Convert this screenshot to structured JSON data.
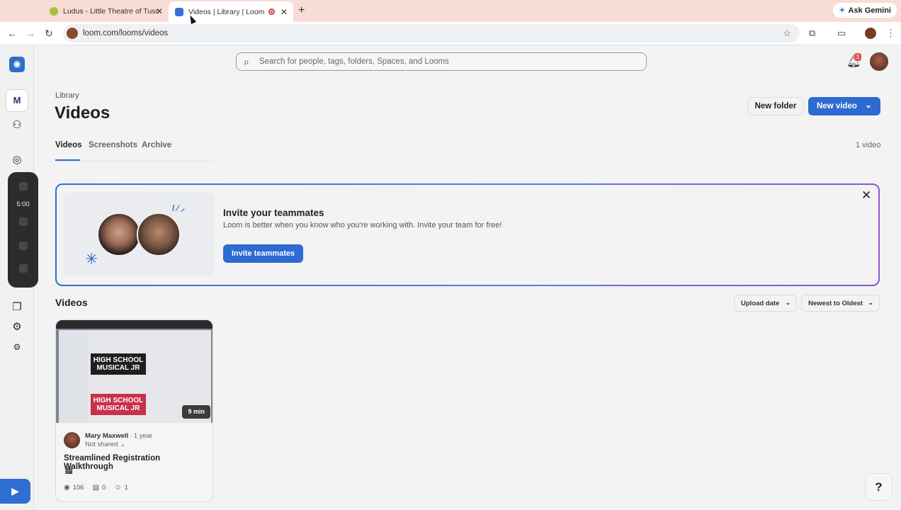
{
  "browser": {
    "tabs": [
      {
        "title": "Ludus - Little Theatre of Tusc",
        "fav_color": "#a8c03c"
      },
      {
        "title": "Videos | Library | Loom",
        "fav_color": "#3b6fd1"
      }
    ],
    "new_tab_glyph": "+",
    "close_glyph": "✕",
    "ask_gemini": "Ask Gemini",
    "url": "loom.com/looms/videos"
  },
  "app": {
    "workspace_initial": "M",
    "recorder_time": "5:00",
    "search_placeholder": "Search for people, tags, folders, Spaces, and Looms",
    "notification_count": "1",
    "breadcrumb": "Library",
    "title": "Videos",
    "new_folder": "New folder",
    "new_video": "New video",
    "tabs": [
      "Videos",
      "Screenshots",
      "Archive"
    ],
    "active_tab": "Videos",
    "video_count": "1 video",
    "accent_color": "#2d6ad1"
  },
  "banner": {
    "title": "Invite your teammates",
    "body": "Loom is better when you know who you're working with. Invite your team for free!",
    "button": "Invite teammates"
  },
  "videos_section": {
    "title": "Videos",
    "sort_field": "Upload date",
    "sort_order": "Newest to Oldest"
  },
  "video": {
    "duration": "9 min",
    "poster_text": "HIGH SCHOOL MUSICAL JR",
    "author": "Mary Maxwell",
    "age": "1 year",
    "sharing": "Not shared",
    "title": "Streamlined Registration Walkthrough",
    "views": "106",
    "comments": "0",
    "reactions": "1"
  },
  "help_label": "?"
}
